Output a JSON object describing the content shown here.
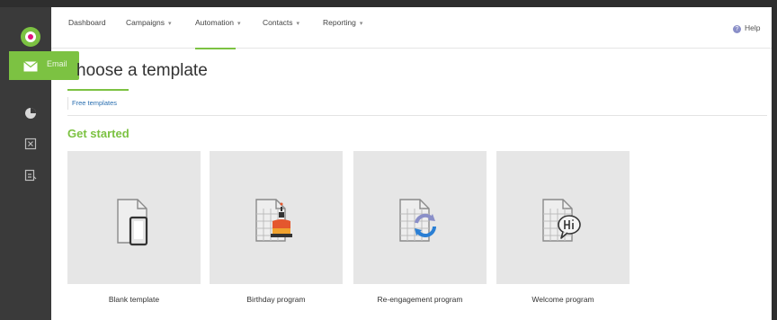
{
  "sidebar": {
    "flyout_label": "Email"
  },
  "nav": {
    "items": [
      {
        "label": "Dashboard",
        "caret": ""
      },
      {
        "label": "Campaigns",
        "caret": "▾"
      },
      {
        "label": "Automation",
        "caret": "▾"
      },
      {
        "label": "Contacts",
        "caret": "▾"
      },
      {
        "label": "Reporting",
        "caret": "▾"
      }
    ],
    "active": "Automation",
    "help_label": "Help",
    "help_icon": "?"
  },
  "page": {
    "title": "hoose a template",
    "tab": "Free templates",
    "section_title": "Get started"
  },
  "templates": [
    {
      "name": "Blank template",
      "icon": "blank-template-icon"
    },
    {
      "name": "Birthday program",
      "icon": "birthday-program-icon"
    },
    {
      "name": "Re-engagement program",
      "icon": "re-engagement-icon"
    },
    {
      "name": "Welcome program",
      "icon": "welcome-program-icon"
    }
  ],
  "colors": {
    "accent": "#7cc242",
    "sidebar": "#3a3a3a",
    "link": "#2a6fb0",
    "card_bg": "#e6e6e6"
  }
}
